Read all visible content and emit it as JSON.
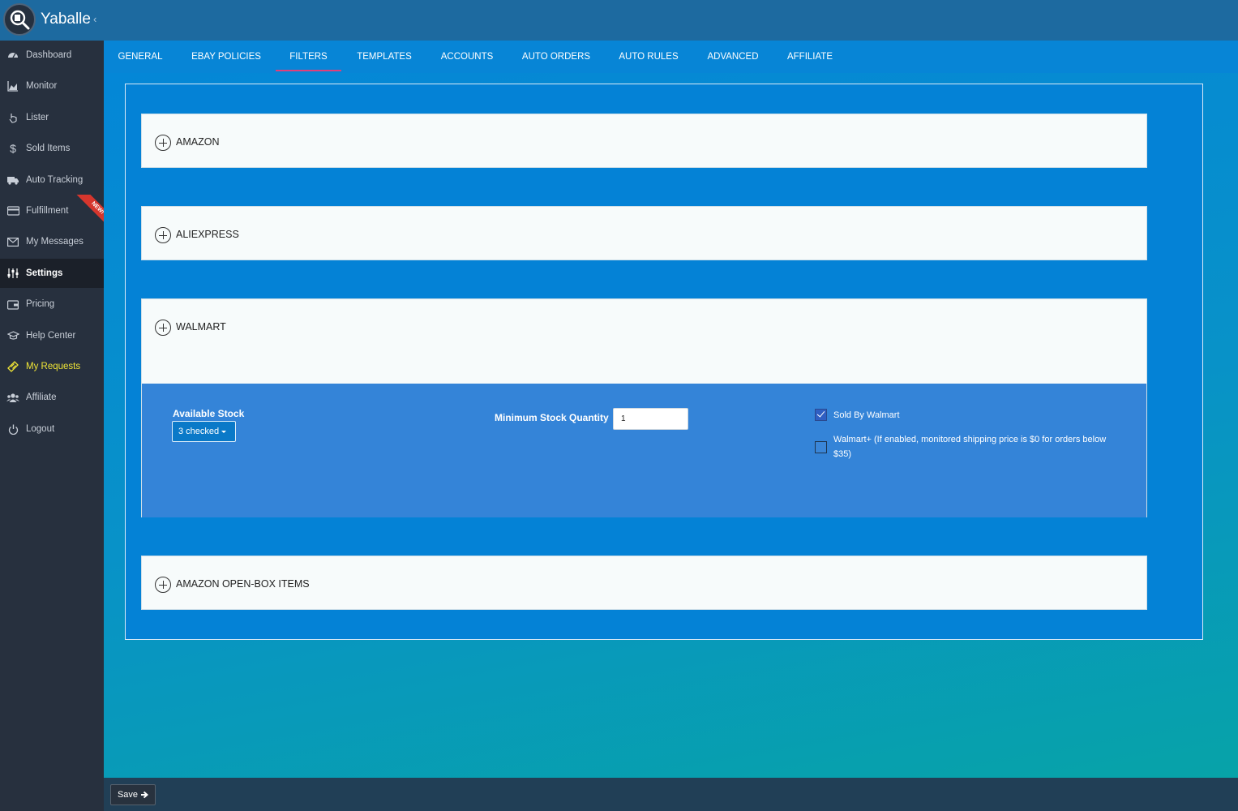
{
  "app": {
    "name": "Yaballe",
    "collapse_glyph": "‹"
  },
  "sidebar": {
    "items": [
      {
        "label": "Dashboard",
        "icon": "dashboard-icon"
      },
      {
        "label": "Monitor",
        "icon": "area-chart-icon"
      },
      {
        "label": "Lister",
        "icon": "hand-pointer-icon"
      },
      {
        "label": "Sold Items",
        "icon": "dollar-icon"
      },
      {
        "label": "Auto Tracking",
        "icon": "truck-icon"
      },
      {
        "label": "Fulfillment",
        "icon": "credit-card-icon"
      },
      {
        "label": "My Messages",
        "icon": "envelope-icon"
      },
      {
        "label": "Settings",
        "icon": "sliders-icon",
        "active": true
      },
      {
        "label": "Pricing",
        "icon": "wallet-icon"
      },
      {
        "label": "Help Center",
        "icon": "graduation-cap-icon"
      },
      {
        "label": "My Requests",
        "icon": "ticket-icon",
        "highlight": true
      },
      {
        "label": "Affiliate",
        "icon": "users-icon"
      },
      {
        "label": "Logout",
        "icon": "power-icon"
      }
    ],
    "new_badge": "NEW!"
  },
  "tabs": [
    {
      "label": "GENERAL"
    },
    {
      "label": "EBAY POLICIES"
    },
    {
      "label": "FILTERS",
      "active": true
    },
    {
      "label": "TEMPLATES"
    },
    {
      "label": "ACCOUNTS"
    },
    {
      "label": "AUTO ORDERS"
    },
    {
      "label": "AUTO RULES"
    },
    {
      "label": "ADVANCED"
    },
    {
      "label": "AFFILIATE"
    }
  ],
  "filters": {
    "sections": [
      {
        "title": "AMAZON",
        "expanded": false
      },
      {
        "title": "ALIEXPRESS",
        "expanded": false
      },
      {
        "title": "WALMART",
        "expanded": true
      },
      {
        "title": "AMAZON OPEN-BOX ITEMS",
        "expanded": false
      }
    ],
    "walmart": {
      "available_stock_label": "Available Stock",
      "available_stock_value": "3 checked",
      "min_stock_label": "Minimum Stock Quantity",
      "min_stock_value": "1",
      "sold_by_walmart_label": "Sold By Walmart",
      "sold_by_walmart_checked": true,
      "walmart_plus_label": "Walmart+ (If enabled, monitored shipping price is $0 for orders below $35)",
      "walmart_plus_checked": false
    }
  },
  "footer": {
    "save_label": "Save",
    "save_icon": "arrow-right-icon"
  },
  "colors": {
    "accent_tab": "#e0407a",
    "sidebar_bg": "#27303e",
    "header_bg": "#1d6aa0",
    "highlight": "#f0e536"
  }
}
